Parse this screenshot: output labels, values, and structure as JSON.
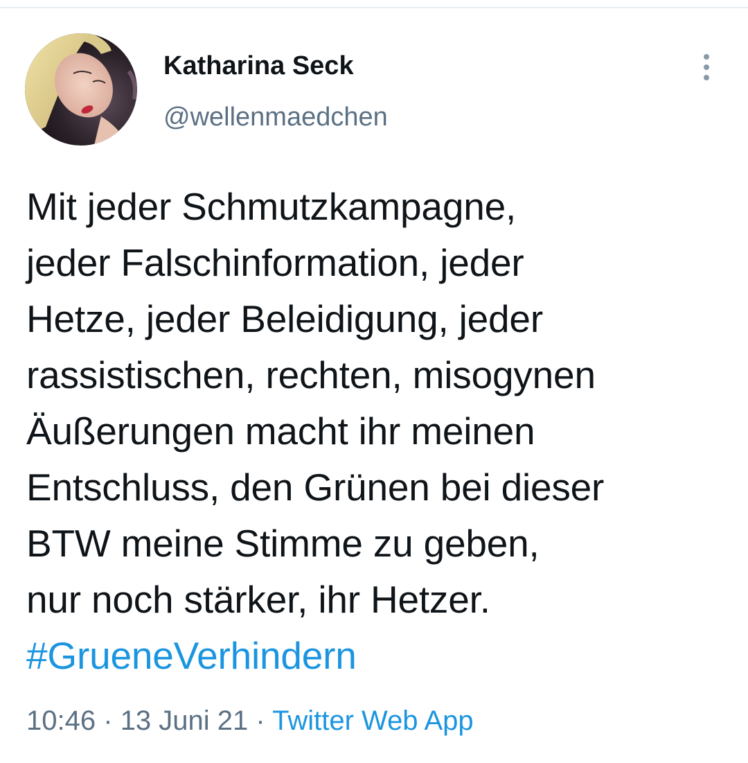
{
  "tweet": {
    "display_name": "Katharina Seck",
    "handle": "@wellenmaedchen",
    "text_lines": [
      "Mit jeder Schmutzkampagne,",
      "jeder Falschinformation, jeder",
      "Hetze, jeder Beleidigung, jeder",
      "rassistischen, rechten, misogynen",
      "Äußerungen macht ihr meinen",
      "Entschluss, den Grünen bei dieser",
      "BTW meine Stimme zu geben,",
      "nur noch stärker, ihr Hetzer."
    ],
    "hashtag": "#GrueneVerhindern",
    "time": "10:46",
    "separator": "·",
    "date": "13 Juni 21",
    "source": "Twitter Web App"
  },
  "icons": {
    "more": "more-vertical-icon"
  },
  "colors": {
    "text": "#0f1419",
    "secondary": "#5b7083",
    "link": "#1b95e0",
    "divider": "#e6ecf0"
  }
}
